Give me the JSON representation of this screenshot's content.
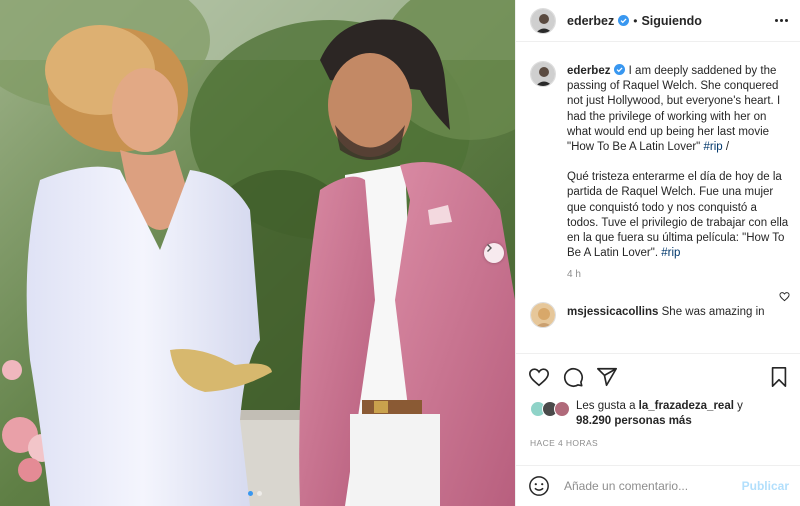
{
  "post": {
    "username": "ederbez",
    "follow_status": "Siguiendo",
    "separator": "•"
  },
  "caption": {
    "username": "ederbez",
    "text_en": "I am deeply saddened by the passing of Raquel Welch. She conquered not just Hollywood, but everyone's heart. I had the privilege of working with her on what would end up being her last movie \"How To Be A Latin Lover\"",
    "hashtag_en": "#rip",
    "tail_en": " /",
    "text_es": "Qué tristeza enterarme el día de hoy de la partida de Raquel Welch. Fue una mujer que conquistó todo y nos conquistó a todos. Tuve el privilegio de trabajar con ella en la que fuera su última película: \"How To Be A Latin Lover\".",
    "hashtag_es": "#rip",
    "time": "4 h"
  },
  "comment2": {
    "username": "msjessicacollins",
    "text": "She was amazing in"
  },
  "icons": {
    "like": "heart-icon",
    "comment": "comment-icon",
    "share": "share-icon",
    "save": "bookmark-icon",
    "emoji": "emoji-icon",
    "more": "more-icon",
    "verified": "verified-badge-icon",
    "next": "chevron-right-icon"
  },
  "likes": {
    "prefix": "Les gusta a ",
    "user": "la_frazadeza_real",
    "middle": " y",
    "count": "98.290 personas más"
  },
  "posted": "HACE 4 HORAS",
  "add_comment": {
    "placeholder": "Añade un comentario...",
    "publish": "Publicar"
  },
  "carousel": {
    "current": 1,
    "total": 2
  },
  "colors": {
    "accent": "#3897f0",
    "verified": "#3897f0",
    "link": "#00376b",
    "publish_disabled": "#b2dffc"
  }
}
